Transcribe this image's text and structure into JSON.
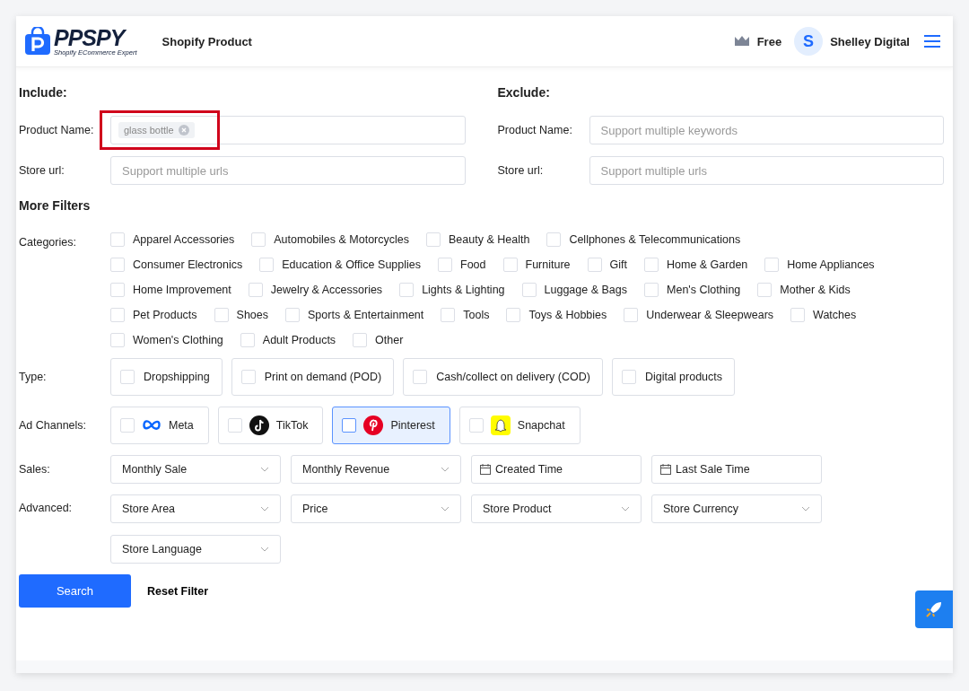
{
  "header": {
    "logo": "PPSPY",
    "logo_tagline": "Shopify ECommerce Expert",
    "title": "Shopify Product",
    "plan": "Free",
    "avatar_letter": "S",
    "user": "Shelley Digital"
  },
  "include": {
    "heading": "Include:",
    "product_label": "Product Name:",
    "product_tags": [
      "glass bottle"
    ],
    "store_label": "Store url:",
    "store_placeholder": "Support multiple urls"
  },
  "exclude": {
    "heading": "Exclude:",
    "product_label": "Product Name:",
    "product_placeholder": "Support multiple keywords",
    "store_label": "Store url:",
    "store_placeholder": "Support multiple urls"
  },
  "more_filters": "More Filters",
  "categories": {
    "label": "Categories:",
    "items": [
      {
        "label": "Apparel Accessories",
        "checked": false
      },
      {
        "label": "Automobiles & Motorcycles",
        "checked": false
      },
      {
        "label": "Beauty & Health",
        "checked": false
      },
      {
        "label": "Cellphones & Telecommunications",
        "checked": false
      },
      {
        "label": "Consumer Electronics",
        "checked": false
      },
      {
        "label": "Education & Office Supplies",
        "checked": false
      },
      {
        "label": "Food",
        "checked": false
      },
      {
        "label": "Furniture",
        "checked": false
      },
      {
        "label": "Gift",
        "checked": false
      },
      {
        "label": "Home & Garden",
        "checked": false
      },
      {
        "label": "Home Appliances",
        "checked": false
      },
      {
        "label": "Home Improvement",
        "checked": false
      },
      {
        "label": "Jewelry & Accessories",
        "checked": false
      },
      {
        "label": "Lights & Lighting",
        "checked": false
      },
      {
        "label": "Luggage & Bags",
        "checked": false
      },
      {
        "label": "Men's Clothing",
        "checked": false
      },
      {
        "label": "Mother & Kids",
        "checked": false
      },
      {
        "label": "Pet Products",
        "checked": false
      },
      {
        "label": "Shoes",
        "checked": false
      },
      {
        "label": "Sports & Entertainment",
        "checked": false
      },
      {
        "label": "Tools",
        "checked": false
      },
      {
        "label": "Toys & Hobbies",
        "checked": false
      },
      {
        "label": "Underwear & Sleepwears",
        "checked": false
      },
      {
        "label": "Watches",
        "checked": false
      },
      {
        "label": "Women's Clothing",
        "checked": false
      },
      {
        "label": "Adult Products",
        "checked": false
      },
      {
        "label": "Other",
        "checked": false
      }
    ]
  },
  "type": {
    "label": "Type:",
    "items": [
      {
        "label": "Dropshipping",
        "checked": false
      },
      {
        "label": "Print on demand (POD)",
        "checked": false
      },
      {
        "label": "Cash/collect on delivery (COD)",
        "checked": false
      },
      {
        "label": "Digital products",
        "checked": false
      }
    ]
  },
  "ad_channels": {
    "label": "Ad Channels:",
    "items": [
      {
        "kind": "meta",
        "label": "Meta",
        "checked": false,
        "selected": false
      },
      {
        "kind": "tiktok",
        "label": "TikTok",
        "checked": false,
        "selected": false
      },
      {
        "kind": "pinterest",
        "label": "Pinterest",
        "checked": false,
        "selected": true
      },
      {
        "kind": "snapchat",
        "label": "Snapchat",
        "checked": false,
        "selected": false
      }
    ]
  },
  "sales": {
    "label": "Sales:",
    "items": [
      {
        "kind": "select",
        "text": "Monthly Sale"
      },
      {
        "kind": "select",
        "text": "Monthly Revenue"
      },
      {
        "kind": "date",
        "text": "Created Time"
      },
      {
        "kind": "date",
        "text": "Last Sale Time"
      }
    ]
  },
  "advanced": {
    "label": "Advanced:",
    "items": [
      {
        "kind": "select",
        "text": "Store Area"
      },
      {
        "kind": "select",
        "text": "Price"
      },
      {
        "kind": "select",
        "text": "Store Product"
      },
      {
        "kind": "select",
        "text": "Store Currency"
      },
      {
        "kind": "select",
        "text": "Store Language"
      }
    ]
  },
  "actions": {
    "search": "Search",
    "reset": "Reset Filter"
  }
}
